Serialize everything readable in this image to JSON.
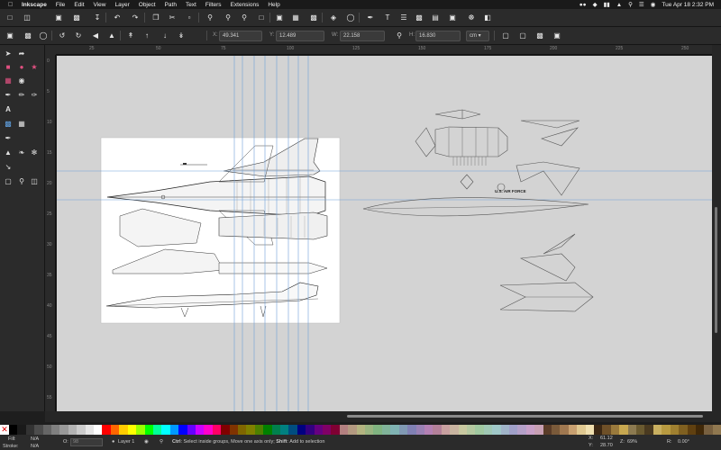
{
  "menubar": {
    "app_name": "Inkscape",
    "menus": [
      "File",
      "Edit",
      "View",
      "Layer",
      "Object",
      "Path",
      "Text",
      "Filters",
      "Extensions",
      "Help"
    ],
    "datetime": "Tue Apr 18  2:32 PM"
  },
  "controls": {
    "x_label": "X:",
    "x_value": "49.341",
    "y_label": "Y:",
    "y_value": "12.489",
    "w_label": "W:",
    "w_value": "22.158",
    "h_label": "H:",
    "h_value": "16.830",
    "unit": "cm"
  },
  "ruler": {
    "h_ticks": [
      "25",
      "50",
      "75",
      "100",
      "125",
      "150",
      "175",
      "200",
      "225",
      "250"
    ],
    "v_ticks": [
      "0",
      "5",
      "10",
      "15",
      "20",
      "25",
      "30",
      "35",
      "40",
      "45",
      "50",
      "55"
    ]
  },
  "artwork": {
    "stamp_text": "U.S. AIR FORCE"
  },
  "status": {
    "fill_label": "Fill:",
    "fill_value": "N/A",
    "stroke_label": "Stroke:",
    "stroke_value": "N/A",
    "opacity_label": "O:",
    "opacity_value": "98",
    "layer": "Layer 1",
    "hint_ctrl": "Ctrl",
    "hint_ctrl_text": ": Select inside groups, Move one axis only; ",
    "hint_shift": "Shift",
    "hint_shift_text": ": Add to selection",
    "x_label": "X:",
    "x_value": "61.12",
    "y_label": "Y:",
    "y_value": "28.70",
    "zoom_label": "Z:",
    "zoom_value": "69%",
    "rotate_label": "R:",
    "rotate_value": "0.00°"
  },
  "palette_colors": [
    "#000000",
    "#1a1a1a",
    "#333333",
    "#4d4d4d",
    "#666666",
    "#808080",
    "#999999",
    "#b3b3b3",
    "#cccccc",
    "#e6e6e6",
    "#ffffff",
    "#ff0000",
    "#ff6600",
    "#ffcc00",
    "#ffff00",
    "#99ff00",
    "#00ff00",
    "#00ff99",
    "#00ffff",
    "#0099ff",
    "#0000ff",
    "#6600ff",
    "#cc00ff",
    "#ff00cc",
    "#ff0066",
    "#800000",
    "#803300",
    "#806600",
    "#808000",
    "#4d8000",
    "#008000",
    "#00804d",
    "#008080",
    "#004d80",
    "#000080",
    "#330080",
    "#660080",
    "#800066",
    "#800033",
    "#b38080",
    "#b39980",
    "#b3b380",
    "#99b380",
    "#80b380",
    "#80b399",
    "#80b3b3",
    "#8099b3",
    "#8080b3",
    "#9980b3",
    "#b380b3",
    "#b38099",
    "#c8a0a0",
    "#c8b4a0",
    "#c8c8a0",
    "#b4c8a0",
    "#a0c8a0",
    "#a0c8b4",
    "#a0c8c8",
    "#a0b4c8",
    "#a0a0c8",
    "#b4a0c8",
    "#c8a0c8",
    "#c8a0b4",
    "#5a3c28",
    "#7a5a3a",
    "#a07850",
    "#c8a070",
    "#e0c890",
    "#f0e0b0",
    "#3c2814",
    "#6e5028",
    "#9a7a3c",
    "#c8a850",
    "#8c7a50",
    "#6a5a30",
    "#4a3a20",
    "#c9b060",
    "#b89a40",
    "#a08030",
    "#806020",
    "#604010",
    "#402808",
    "#786040",
    "#907850"
  ]
}
